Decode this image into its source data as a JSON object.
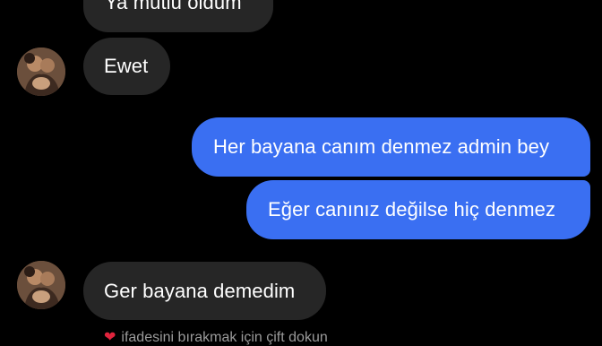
{
  "colors": {
    "background": "#000000",
    "incoming_bubble": "#262626",
    "outgoing_bubble": "#3a6ff2",
    "text": "#ffffff",
    "hint_text": "#9a9a9a",
    "heart": "#e0243d"
  },
  "messages": [
    {
      "direction": "incoming",
      "text": "Ya mutlu oldum"
    },
    {
      "direction": "incoming",
      "text": "Ewet",
      "avatar": "contact-avatar"
    },
    {
      "direction": "outgoing",
      "text": "Her bayana canım denmez admin bey"
    },
    {
      "direction": "outgoing",
      "text": "Eğer canınız değilse hiç denmez"
    },
    {
      "direction": "incoming",
      "text": "Ger bayana demedim",
      "avatar": "contact-avatar"
    }
  ],
  "reaction_hint": {
    "icon": "heart-icon",
    "text": "ifadesini bırakmak için çift dokun"
  }
}
